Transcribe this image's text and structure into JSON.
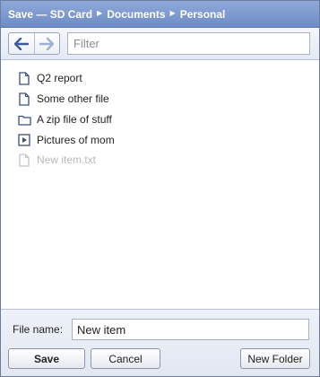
{
  "titlebar": {
    "prefix": "Save —",
    "path": [
      "SD Card",
      "Documents",
      "Personal"
    ]
  },
  "toolbar": {
    "back_icon": "back-arrow-icon",
    "forward_icon": "forward-arrow-icon",
    "filter_placeholder": "Filter",
    "filter_value": ""
  },
  "files": [
    {
      "label": "Q2 report",
      "icon": "document-icon",
      "dimmed": false
    },
    {
      "label": "Some other file",
      "icon": "document-icon",
      "dimmed": false
    },
    {
      "label": "A zip file of stuff",
      "icon": "folder-icon",
      "dimmed": false
    },
    {
      "label": "Pictures of mom",
      "icon": "media-icon",
      "dimmed": false
    },
    {
      "label": "New item.txt",
      "icon": "document-icon",
      "dimmed": true
    }
  ],
  "footer": {
    "file_name_label": "File name:",
    "file_name_value": "New item",
    "save_label": "Save",
    "cancel_label": "Cancel",
    "new_folder_label": "New Folder"
  },
  "colors": {
    "titlebar": "#7f9bd0",
    "accent": "#4a6aa8",
    "dim_text": "#b9b9b9"
  }
}
